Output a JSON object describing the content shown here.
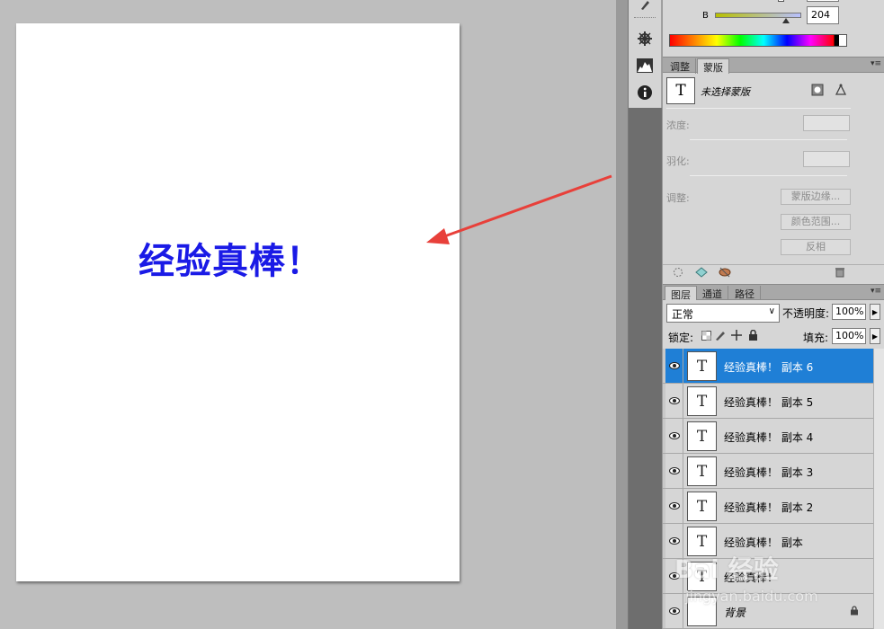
{
  "canvas": {
    "document_text": "经验真棒！",
    "text_color": "#1a1ae6"
  },
  "tool_strip": {
    "icons": [
      "brush-preset-icon",
      "navigator-compass-icon",
      "histogram-icon",
      "info-icon"
    ]
  },
  "color_panel": {
    "channel_label": "B",
    "channel_value": "204"
  },
  "adjust_masks_panel": {
    "tabs": [
      {
        "label": "调整",
        "active": false
      },
      {
        "label": "蒙版",
        "active": true
      }
    ],
    "thumb_glyph": "T",
    "status": "未选择蒙版",
    "density_label": "浓度:",
    "feather_label": "羽化:",
    "adjust_label": "调整:",
    "buttons": [
      "蒙版边缘...",
      "颜色范围...",
      "反相"
    ]
  },
  "layers_panel": {
    "tabs": [
      {
        "label": "图层",
        "active": true
      },
      {
        "label": "通道",
        "active": false
      },
      {
        "label": "路径",
        "active": false
      }
    ],
    "blend_mode": "正常",
    "opacity_label": "不透明度:",
    "opacity_value": "100%",
    "lock_label": "锁定:",
    "fill_label": "填充:",
    "fill_value": "100%",
    "layers": [
      {
        "name": "经验真棒！ 副本 6",
        "thumb": "T",
        "selected": true
      },
      {
        "name": "经验真棒！ 副本 5",
        "thumb": "T",
        "selected": false
      },
      {
        "name": "经验真棒！ 副本 4",
        "thumb": "T",
        "selected": false
      },
      {
        "name": "经验真棒！ 副本 3",
        "thumb": "T",
        "selected": false
      },
      {
        "name": "经验真棒！ 副本 2",
        "thumb": "T",
        "selected": false
      },
      {
        "name": "经验真棒！ 副本",
        "thumb": "T",
        "selected": false
      },
      {
        "name": "经验真棒！",
        "thumb": "T",
        "selected": false
      },
      {
        "name": "背景",
        "thumb": "",
        "selected": false
      }
    ]
  },
  "watermark": {
    "logo_text": "Bai 经验",
    "url": "jingyan.baidu.com"
  },
  "colors": {
    "selection": "#1f7fd6",
    "arrow": "#e8403a"
  }
}
